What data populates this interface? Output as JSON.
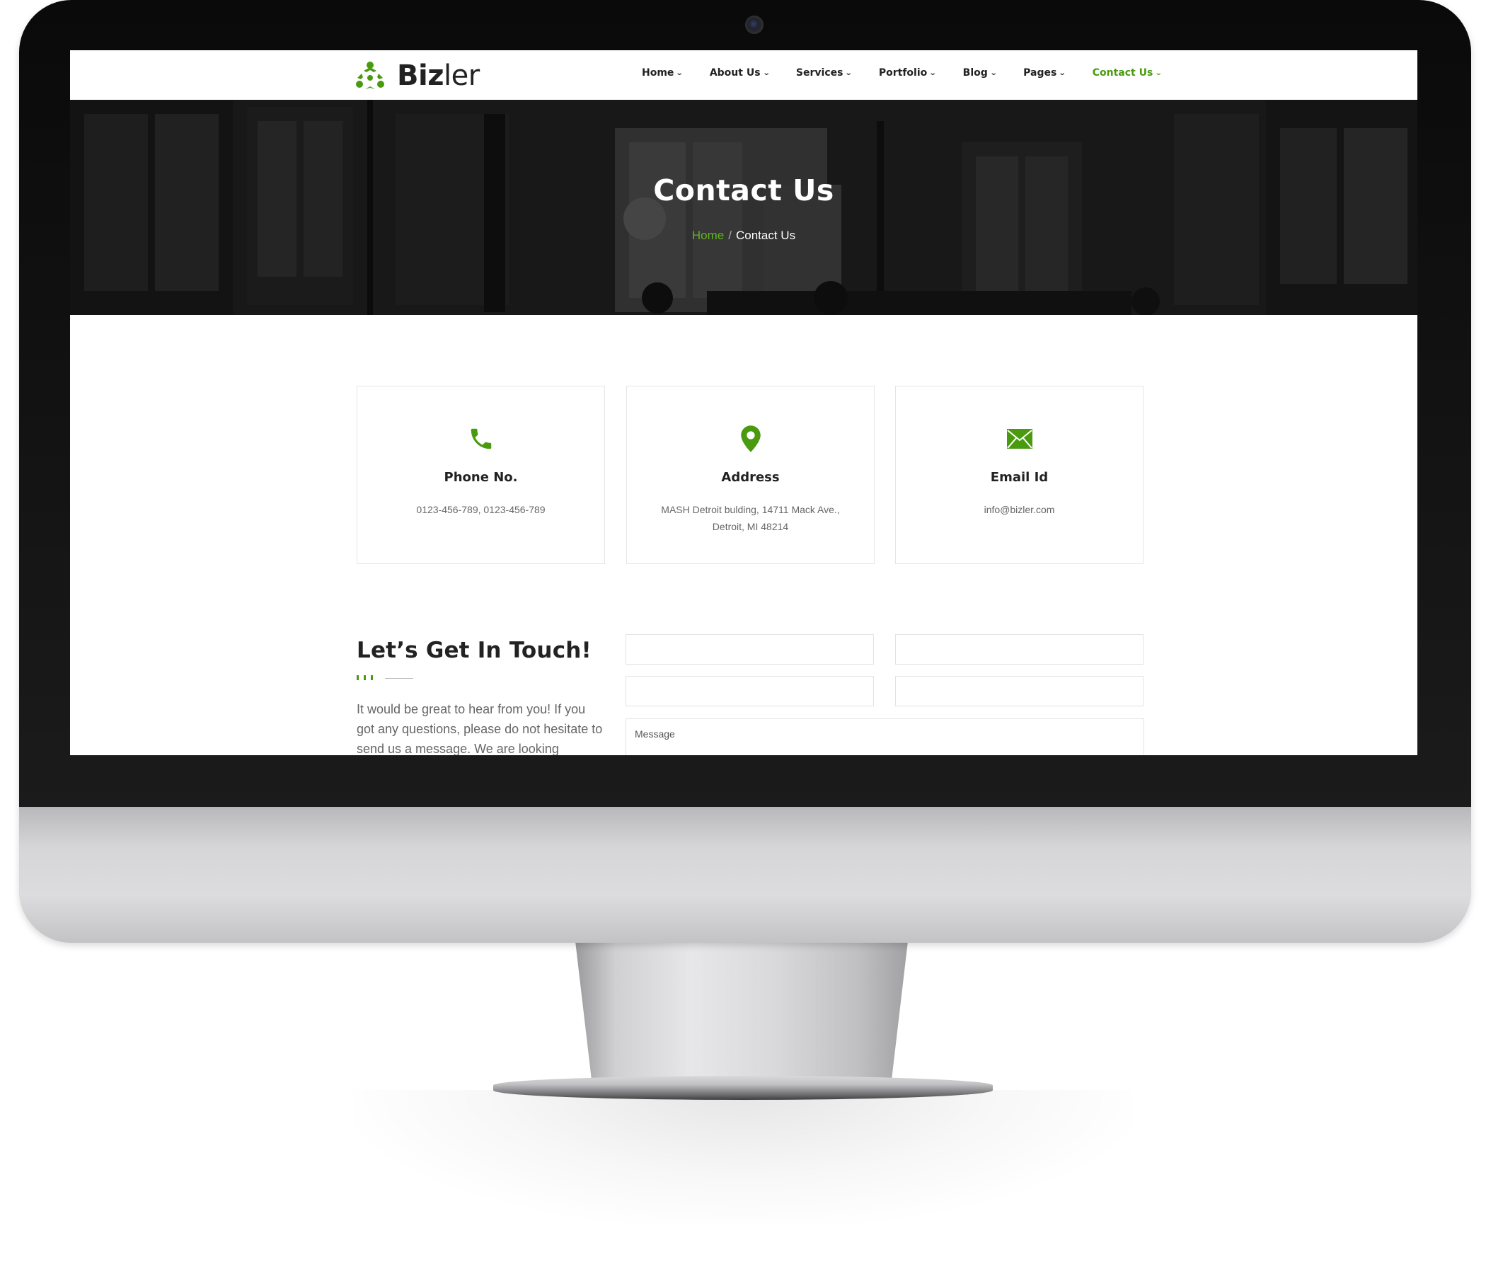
{
  "brand": {
    "name_bold": "Biz",
    "name_light": "ler",
    "accent_color": "#4a9a0f"
  },
  "nav": {
    "items": [
      {
        "label": "Home",
        "active": false
      },
      {
        "label": "About Us",
        "active": false
      },
      {
        "label": "Services",
        "active": false
      },
      {
        "label": "Portfolio",
        "active": false
      },
      {
        "label": "Blog",
        "active": false
      },
      {
        "label": "Pages",
        "active": false
      },
      {
        "label": "Contact Us",
        "active": true
      }
    ],
    "caret_icon": "chevron-down-icon"
  },
  "hero": {
    "title": "Contact Us",
    "breadcrumb": {
      "home": "Home",
      "separator": "/",
      "current": "Contact Us"
    }
  },
  "contact_cards": [
    {
      "icon": "phone-icon",
      "title": "Phone No.",
      "text": "0123-456-789, 0123-456-789"
    },
    {
      "icon": "map-pin-icon",
      "title": "Address",
      "text": "MASH Detroit bulding, 14711 Mack Ave., Detroit, MI 48214"
    },
    {
      "icon": "envelope-icon",
      "title": "Email Id",
      "text": "info@bizler.com"
    }
  ],
  "get_in_touch": {
    "heading": "Let’s Get In Touch!",
    "text": "It would be great to hear from you! If you got any questions, please do not hesitate to send us a message. We are looking"
  },
  "form": {
    "message_placeholder": "Message"
  }
}
